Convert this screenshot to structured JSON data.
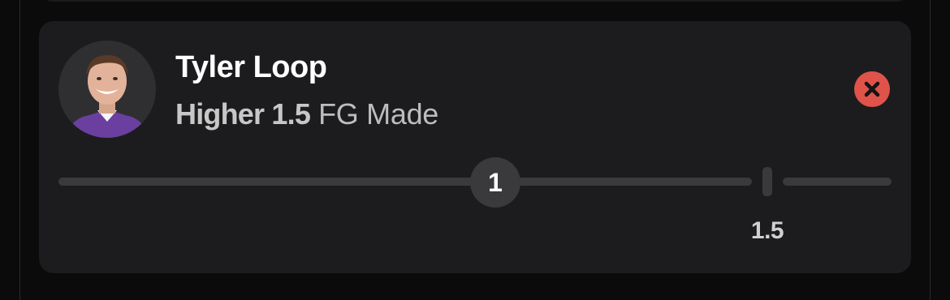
{
  "pick": {
    "player_name": "Tyler Loop",
    "direction": "Higher 1.5",
    "stat": "FG Made",
    "line_label": "1.5",
    "slider_value": "1",
    "avatar_icon": "player-headshot",
    "remove_icon": "close-x-icon"
  },
  "colors": {
    "card_background": "#1c1c1e",
    "remove_button": "#e0534a",
    "jersey": "#6a3fa0"
  }
}
